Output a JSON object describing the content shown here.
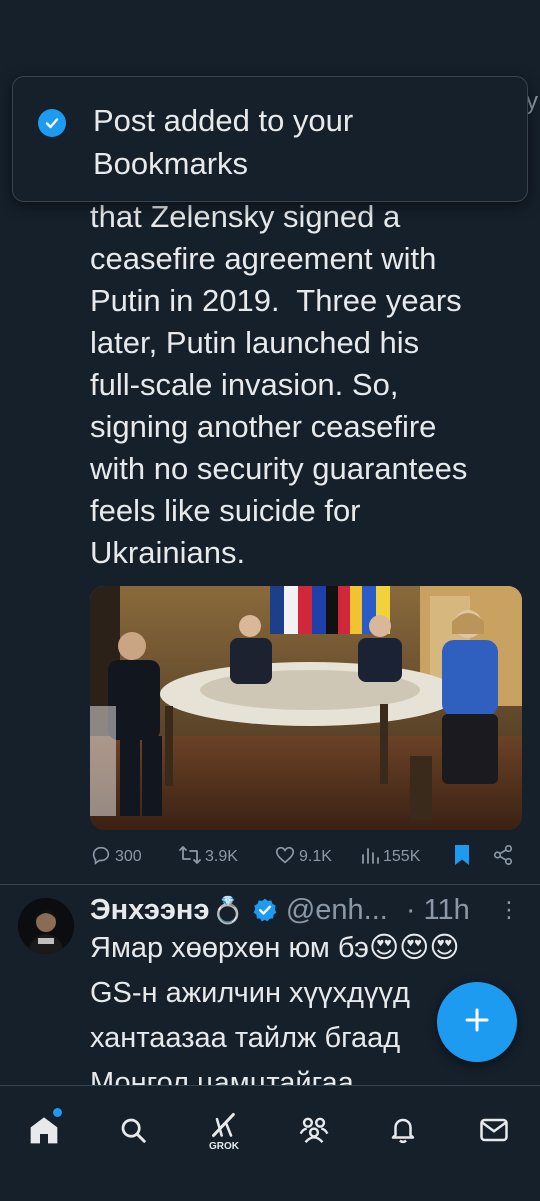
{
  "toast": {
    "message": "Post added to your Bookmarks",
    "icon": "check-circle-icon"
  },
  "background_edge": {
    "text": "y"
  },
  "post": {
    "text": "that Zelensky signed a\nceasefire agreement with\nPutin in 2019.  Three years\nlater, Putin launched his\nfull-scale invasion. So,\nsigning another ceasefire\nwith no security guarantees\nfeels like suicide for\nUkrainians.",
    "media": {
      "kind": "photo",
      "description_icon": "summit-photo"
    },
    "stats": {
      "replies": "300",
      "reposts": "3.9K",
      "likes": "9.1K",
      "views": "155K"
    },
    "bookmarked": true
  },
  "reply": {
    "name": "Энхээнэ",
    "name_emoji": "💍",
    "verified": true,
    "handle": "@enh...",
    "time": "· 11h",
    "text": "Ямар хөөрхөн юм бэ😍😍😍\nGS-н ажилчин хүүхдүүд\nхантаазаа тайлж бгаад\nМонгол цамцтайгаа"
  },
  "nav": {
    "items": [
      "home",
      "search",
      "grok",
      "communities",
      "notifications",
      "messages"
    ],
    "grok_label": "GROK",
    "home_has_badge": true
  },
  "colors": {
    "accent": "#1d9bf0",
    "background": "#15202b",
    "muted": "#8b98a5"
  }
}
